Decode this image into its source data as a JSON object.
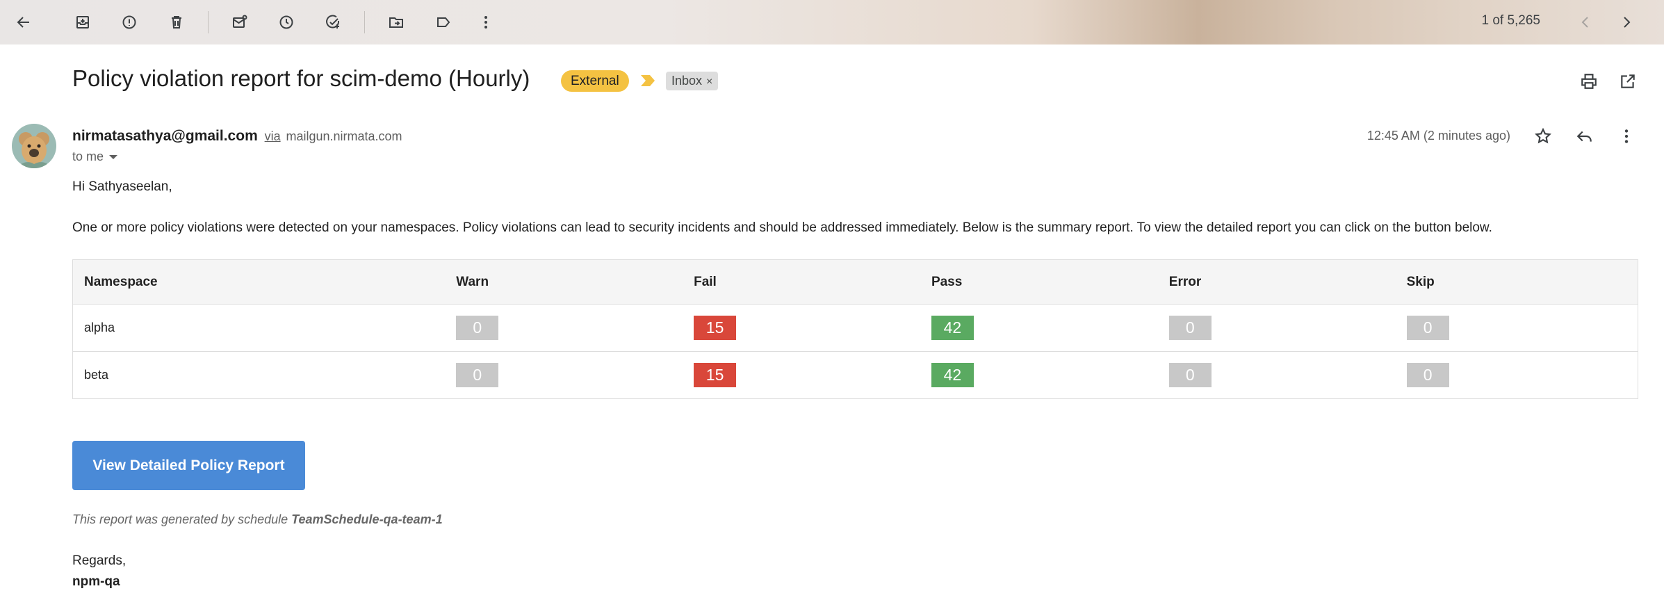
{
  "toolbar": {
    "pager_text": "1 of 5,265"
  },
  "header": {
    "subject": "Policy violation report for scim-demo (Hourly)",
    "external_label": "External",
    "inbox_label": "Inbox",
    "inbox_remove": "×"
  },
  "sender": {
    "email": "nirmatasathya@gmail.com",
    "via_label": "via",
    "via_domain": "mailgun.nirmata.com",
    "to_label": "to me",
    "timestamp": "12:45 AM (2 minutes ago)"
  },
  "body": {
    "greeting": "Hi Sathyaseelan,",
    "intro": "One or more policy violations were detected on your namespaces. Policy violations can lead to security incidents and should be addressed immediately. Below is the summary report. To view the detailed report you can click on the button below.",
    "table": {
      "headers": [
        "Namespace",
        "Warn",
        "Fail",
        "Pass",
        "Error",
        "Skip"
      ],
      "rows": [
        {
          "namespace": "alpha",
          "warn": "0",
          "fail": "15",
          "pass": "42",
          "error": "0",
          "skip": "0"
        },
        {
          "namespace": "beta",
          "warn": "0",
          "fail": "15",
          "pass": "42",
          "error": "0",
          "skip": "0"
        }
      ]
    },
    "cta_label": "View Detailed Policy Report",
    "footnote_prefix": "This report was generated by schedule ",
    "footnote_schedule": "TeamSchedule-qa-team-1",
    "regards": "Regards,",
    "signoff": "npm-qa"
  },
  "colors": {
    "external_chip": "#f4c242",
    "fail_badge": "#d9473a",
    "pass_badge": "#5aaa61",
    "neutral_badge": "#c8c8c8",
    "cta_button": "#4a8ad7"
  },
  "icons": {
    "toolbar": [
      "back-arrow-icon",
      "archive-icon",
      "report-spam-icon",
      "delete-icon",
      "mark-unread-icon",
      "snooze-icon",
      "add-task-icon",
      "move-to-icon",
      "label-icon",
      "more-vert-icon",
      "newer-chevron-icon",
      "older-chevron-icon"
    ],
    "header": [
      "importance-marker-icon",
      "print-icon",
      "open-in-new-icon"
    ],
    "message": [
      "star-icon",
      "reply-icon",
      "more-vert-icon"
    ]
  }
}
